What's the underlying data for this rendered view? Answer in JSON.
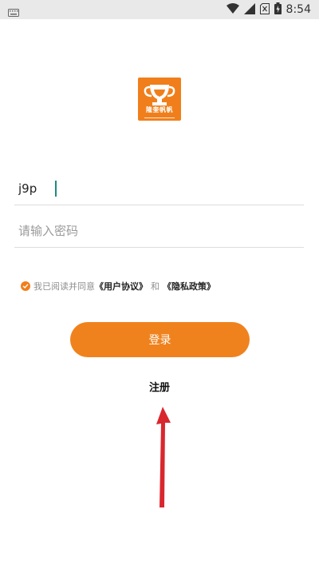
{
  "status_bar": {
    "time": "8:54",
    "icons": [
      "keyboard-icon",
      "wifi-icon",
      "signal-icon",
      "no-sim-icon",
      "battery-icon"
    ]
  },
  "logo": {
    "text": "隆奎帆帆"
  },
  "form": {
    "account_value": "j9p",
    "password_placeholder": "请输入密码"
  },
  "agreement": {
    "checked": true,
    "prefix": "我已阅读并同意",
    "user_agreement": "《用户协议》",
    "and": "和",
    "privacy_policy": "《隐私政策》"
  },
  "buttons": {
    "login": "登录",
    "register": "注册"
  },
  "colors": {
    "accent": "#f0821e",
    "caret": "#1f8a7e",
    "annotation_arrow": "#d9272e"
  }
}
